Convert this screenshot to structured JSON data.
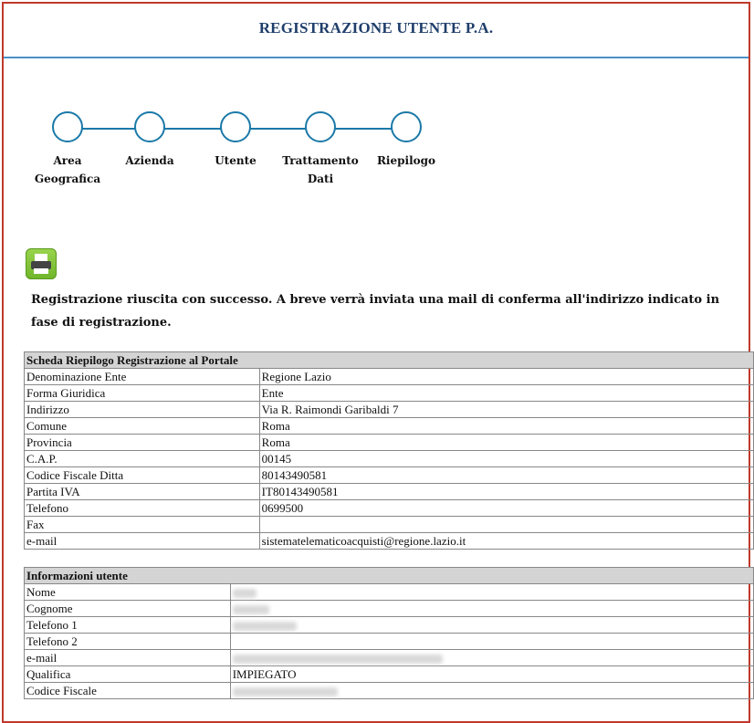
{
  "header": {
    "title": "REGISTRAZIONE UTENTE P.A."
  },
  "steps": [
    {
      "label": "Area Geografica"
    },
    {
      "label": "Azienda"
    },
    {
      "label": "Utente"
    },
    {
      "label": "Trattamento Dati"
    },
    {
      "label": "Riepilogo"
    }
  ],
  "print_icon": "printer-icon",
  "message": "Registrazione riuscita con successo. A breve verrà inviata una mail di conferma all'indirizzo indicato in fase di registrazione.",
  "company_table": {
    "title": "Scheda Riepilogo Registrazione al Portale",
    "rows": [
      {
        "label": "Denominazione Ente",
        "value": "Regione Lazio"
      },
      {
        "label": "Forma Giuridica",
        "value": "Ente"
      },
      {
        "label": "Indirizzo",
        "value": "Via R. Raimondi Garibaldi 7"
      },
      {
        "label": "Comune",
        "value": "Roma"
      },
      {
        "label": "Provincia",
        "value": "Roma"
      },
      {
        "label": "C.A.P.",
        "value": "00145"
      },
      {
        "label": "Codice Fiscale Ditta",
        "value": "80143490581"
      },
      {
        "label": "Partita IVA",
        "value": "IT80143490581"
      },
      {
        "label": "Telefono",
        "value": "0699500"
      },
      {
        "label": "Fax",
        "value": ""
      },
      {
        "label": "e-mail",
        "value": "sistematelematicoacquisti@regione.lazio.it"
      }
    ]
  },
  "user_table": {
    "title": "Informazioni utente",
    "rows": [
      {
        "label": "Nome",
        "value": ""
      },
      {
        "label": "Cognome",
        "value": ""
      },
      {
        "label": "Telefono 1",
        "value": ""
      },
      {
        "label": "Telefono 2",
        "value": ""
      },
      {
        "label": "e-mail",
        "value": ""
      },
      {
        "label": "Qualifica",
        "value": "IMPIEGATO"
      },
      {
        "label": "Codice Fiscale",
        "value": ""
      }
    ]
  },
  "colors": {
    "accent": "#1b79a8",
    "frame": "#c0392b",
    "title": "#1f3e6b",
    "table_header": "#d4d4d4"
  }
}
